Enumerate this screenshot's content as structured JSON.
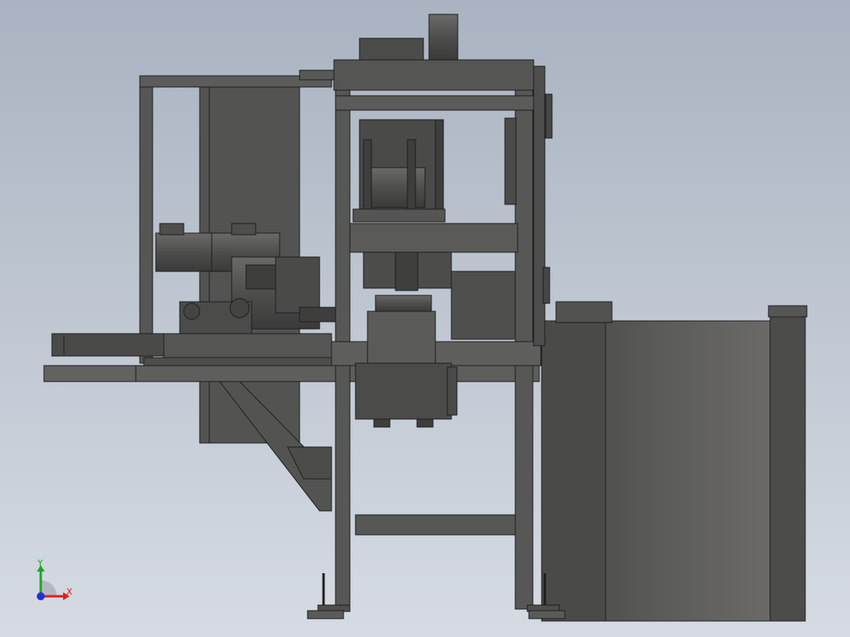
{
  "scene": {
    "background_top": "#a9b3c1",
    "background_bottom": "#d6dbe3",
    "machine_color": "#5a5a58",
    "machine_dark": "#3f3f3e",
    "machine_edge": "#1e1e1e",
    "enclosure_light": "#6e6d69"
  },
  "triad": {
    "x_label": "X",
    "y_label": "Y",
    "x_color": "#e0201b",
    "y_color": "#1fa51f",
    "z_color": "#1f2fd6"
  }
}
